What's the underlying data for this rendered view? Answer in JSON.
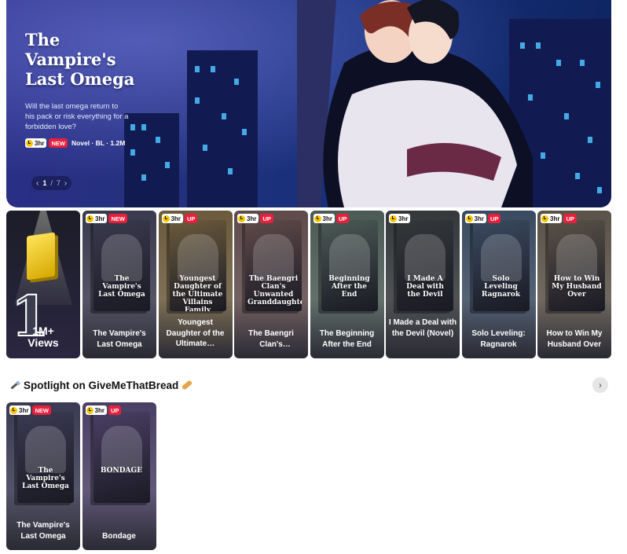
{
  "hero": {
    "title": "The\nVampire's\nLast Omega",
    "description": "Will the last omega return to his pack or risk everything for a forbidden love?",
    "time_badge": "3hr",
    "status_badge": "NEW",
    "tags": "Novel · BL · 1.2M",
    "pager": {
      "current": "1",
      "separator": "/",
      "total": "7"
    }
  },
  "ranking": {
    "views_label": "1M+\nViews",
    "rank_number": "1"
  },
  "top_stories": [
    {
      "title": "The Vampire's Last Omega",
      "time": "3hr",
      "badge": "NEW",
      "cover_text": "The Vampire's Last Omega",
      "bg": "#3a3a4e"
    },
    {
      "title": "Youngest Daughter of the Ultimate…",
      "time": "3hr",
      "badge": "UP",
      "cover_text": "Youngest Daughter of the Ultimate Villains Family",
      "bg": "#6b5a3c"
    },
    {
      "title": "The Baengri Clan's Unwanted…",
      "time": "3hr",
      "badge": "UP",
      "cover_text": "The Baengri Clan's Unwanted Granddaughter",
      "bg": "#5f4a4a"
    },
    {
      "title": "The Beginning After the End",
      "time": "3hr",
      "badge": "UP",
      "cover_text": "Beginning After the End",
      "bg": "#4b5a55"
    },
    {
      "title": "I Made a Deal with the Devil (Novel)",
      "time": "3hr",
      "badge": "",
      "cover_text": "I Made A Deal with the Devil",
      "bg": "#34383a"
    },
    {
      "title": "Solo Leveling: Ragnarok",
      "time": "3hr",
      "badge": "UP",
      "cover_text": "Solo Leveling Ragnarok",
      "bg": "#3a4a60"
    },
    {
      "title": "How to Win My Husband Over",
      "time": "3hr",
      "badge": "UP",
      "cover_text": "How to Win My Husband Over",
      "bg": "#5a5248"
    }
  ],
  "spotlight": {
    "title": "Spotlight on GiveMeThatBread",
    "stories": [
      {
        "title": "The Vampire's Last Omega",
        "time": "3hr",
        "badge": "NEW",
        "cover_text": "The Vampire's Last Omega",
        "bg": "#3a3a52"
      },
      {
        "title": "Bondage",
        "time": "3hr",
        "badge": "UP",
        "cover_text": "BONDAGE",
        "bg": "#4a3f64"
      }
    ]
  },
  "colors": {
    "accent_red": "#e8203c",
    "clock_yellow": "#f5c400",
    "hero_blue": "#24307d"
  }
}
